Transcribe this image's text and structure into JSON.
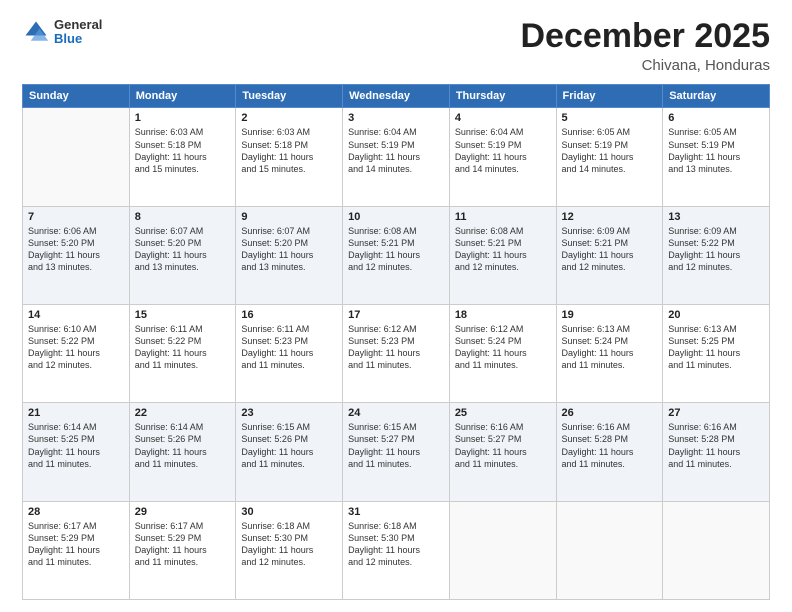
{
  "logo": {
    "general": "General",
    "blue": "Blue"
  },
  "header": {
    "month": "December 2025",
    "location": "Chivana, Honduras"
  },
  "days_of_week": [
    "Sunday",
    "Monday",
    "Tuesday",
    "Wednesday",
    "Thursday",
    "Friday",
    "Saturday"
  ],
  "weeks": [
    [
      {
        "day": "",
        "info": ""
      },
      {
        "day": "1",
        "info": "Sunrise: 6:03 AM\nSunset: 5:18 PM\nDaylight: 11 hours\nand 15 minutes."
      },
      {
        "day": "2",
        "info": "Sunrise: 6:03 AM\nSunset: 5:18 PM\nDaylight: 11 hours\nand 15 minutes."
      },
      {
        "day": "3",
        "info": "Sunrise: 6:04 AM\nSunset: 5:19 PM\nDaylight: 11 hours\nand 14 minutes."
      },
      {
        "day": "4",
        "info": "Sunrise: 6:04 AM\nSunset: 5:19 PM\nDaylight: 11 hours\nand 14 minutes."
      },
      {
        "day": "5",
        "info": "Sunrise: 6:05 AM\nSunset: 5:19 PM\nDaylight: 11 hours\nand 14 minutes."
      },
      {
        "day": "6",
        "info": "Sunrise: 6:05 AM\nSunset: 5:19 PM\nDaylight: 11 hours\nand 13 minutes."
      }
    ],
    [
      {
        "day": "7",
        "info": ""
      },
      {
        "day": "8",
        "info": "Sunrise: 6:07 AM\nSunset: 5:20 PM\nDaylight: 11 hours\nand 13 minutes."
      },
      {
        "day": "9",
        "info": "Sunrise: 6:07 AM\nSunset: 5:20 PM\nDaylight: 11 hours\nand 13 minutes."
      },
      {
        "day": "10",
        "info": "Sunrise: 6:08 AM\nSunset: 5:21 PM\nDaylight: 11 hours\nand 12 minutes."
      },
      {
        "day": "11",
        "info": "Sunrise: 6:08 AM\nSunset: 5:21 PM\nDaylight: 11 hours\nand 12 minutes."
      },
      {
        "day": "12",
        "info": "Sunrise: 6:09 AM\nSunset: 5:21 PM\nDaylight: 11 hours\nand 12 minutes."
      },
      {
        "day": "13",
        "info": "Sunrise: 6:09 AM\nSunset: 5:22 PM\nDaylight: 11 hours\nand 12 minutes."
      }
    ],
    [
      {
        "day": "14",
        "info": ""
      },
      {
        "day": "15",
        "info": "Sunrise: 6:11 AM\nSunset: 5:22 PM\nDaylight: 11 hours\nand 11 minutes."
      },
      {
        "day": "16",
        "info": "Sunrise: 6:11 AM\nSunset: 5:23 PM\nDaylight: 11 hours\nand 11 minutes."
      },
      {
        "day": "17",
        "info": "Sunrise: 6:12 AM\nSunset: 5:23 PM\nDaylight: 11 hours\nand 11 minutes."
      },
      {
        "day": "18",
        "info": "Sunrise: 6:12 AM\nSunset: 5:24 PM\nDaylight: 11 hours\nand 11 minutes."
      },
      {
        "day": "19",
        "info": "Sunrise: 6:13 AM\nSunset: 5:24 PM\nDaylight: 11 hours\nand 11 minutes."
      },
      {
        "day": "20",
        "info": "Sunrise: 6:13 AM\nSunset: 5:25 PM\nDaylight: 11 hours\nand 11 minutes."
      }
    ],
    [
      {
        "day": "21",
        "info": ""
      },
      {
        "day": "22",
        "info": "Sunrise: 6:14 AM\nSunset: 5:26 PM\nDaylight: 11 hours\nand 11 minutes."
      },
      {
        "day": "23",
        "info": "Sunrise: 6:15 AM\nSunset: 5:26 PM\nDaylight: 11 hours\nand 11 minutes."
      },
      {
        "day": "24",
        "info": "Sunrise: 6:15 AM\nSunset: 5:27 PM\nDaylight: 11 hours\nand 11 minutes."
      },
      {
        "day": "25",
        "info": "Sunrise: 6:16 AM\nSunset: 5:27 PM\nDaylight: 11 hours\nand 11 minutes."
      },
      {
        "day": "26",
        "info": "Sunrise: 6:16 AM\nSunset: 5:28 PM\nDaylight: 11 hours\nand 11 minutes."
      },
      {
        "day": "27",
        "info": "Sunrise: 6:16 AM\nSunset: 5:28 PM\nDaylight: 11 hours\nand 11 minutes."
      }
    ],
    [
      {
        "day": "28",
        "info": "Sunrise: 6:17 AM\nSunset: 5:29 PM\nDaylight: 11 hours\nand 11 minutes."
      },
      {
        "day": "29",
        "info": "Sunrise: 6:17 AM\nSunset: 5:29 PM\nDaylight: 11 hours\nand 11 minutes."
      },
      {
        "day": "30",
        "info": "Sunrise: 6:18 AM\nSunset: 5:30 PM\nDaylight: 11 hours\nand 12 minutes."
      },
      {
        "day": "31",
        "info": "Sunrise: 6:18 AM\nSunset: 5:30 PM\nDaylight: 11 hours\nand 12 minutes."
      },
      {
        "day": "",
        "info": ""
      },
      {
        "day": "",
        "info": ""
      },
      {
        "day": "",
        "info": ""
      }
    ]
  ],
  "week7_info": {
    "day7": "Sunrise: 6:06 AM\nSunset: 5:20 PM\nDaylight: 11 hours\nand 13 minutes.",
    "day14": "Sunrise: 6:10 AM\nSunset: 5:22 PM\nDaylight: 11 hours\nand 12 minutes.",
    "day21": "Sunrise: 6:14 AM\nSunset: 5:25 PM\nDaylight: 11 hours\nand 11 minutes."
  }
}
